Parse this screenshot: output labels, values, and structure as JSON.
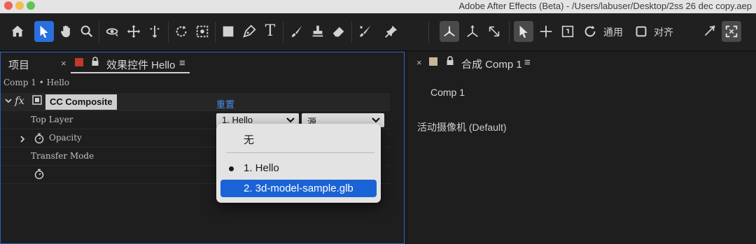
{
  "titlebar": {
    "title": "Adobe After Effects (Beta) - /Users/labuser/Desktop/2ss 26 dec copy.aep"
  },
  "toolbar": {
    "tools": [
      "home-icon",
      "selection-arrow-icon",
      "hand-icon",
      "zoom-icon",
      "orbit-camera-icon",
      "pan-camera-icon",
      "dolly-camera-icon",
      "rotate-icon",
      "pan-behind-icon",
      "rectangle-icon",
      "pen-icon",
      "type-icon",
      "brush-icon",
      "clone-stamp-icon",
      "eraser-icon",
      "roto-brush-icon",
      "puppet-pin-icon"
    ],
    "gizmo_label": "通用",
    "snap_label": "对齐"
  },
  "left_panel": {
    "tab_project": "项目",
    "tab_close": "×",
    "tab_effects": "效果控件 Hello",
    "tab_menu": "≡",
    "breadcrumb": "Comp 1 • Hello",
    "effect": {
      "fx_label": "fx",
      "name": "CC Composite",
      "reset_label": "重置",
      "rows": {
        "top_layer": "Top Layer",
        "opacity": "Opacity",
        "transfer_mode": "Transfer Mode"
      },
      "layer_select_value": "1. Hello",
      "source_select_value": "源"
    }
  },
  "dropdown": {
    "items": [
      {
        "label": "无",
        "checked": false,
        "highlighted": false
      },
      {
        "label": "1. Hello",
        "checked": true,
        "highlighted": false
      },
      {
        "label": "2. 3d-model-sample.glb",
        "checked": false,
        "highlighted": true
      }
    ]
  },
  "right_panel": {
    "tab_close": "×",
    "tab_label": "合成 Comp 1",
    "tab_menu": "≡",
    "comp_tab": "Comp 1",
    "camera_label": "活动摄像机 (Default)"
  },
  "colors": {
    "accent": "#2a6fde",
    "selection": "#1a63d6",
    "panel_focus_border": "#2e62c5",
    "effects_swatch": "#c0392b",
    "comp_swatch": "#c8b59a",
    "link": "#4a8de8"
  }
}
